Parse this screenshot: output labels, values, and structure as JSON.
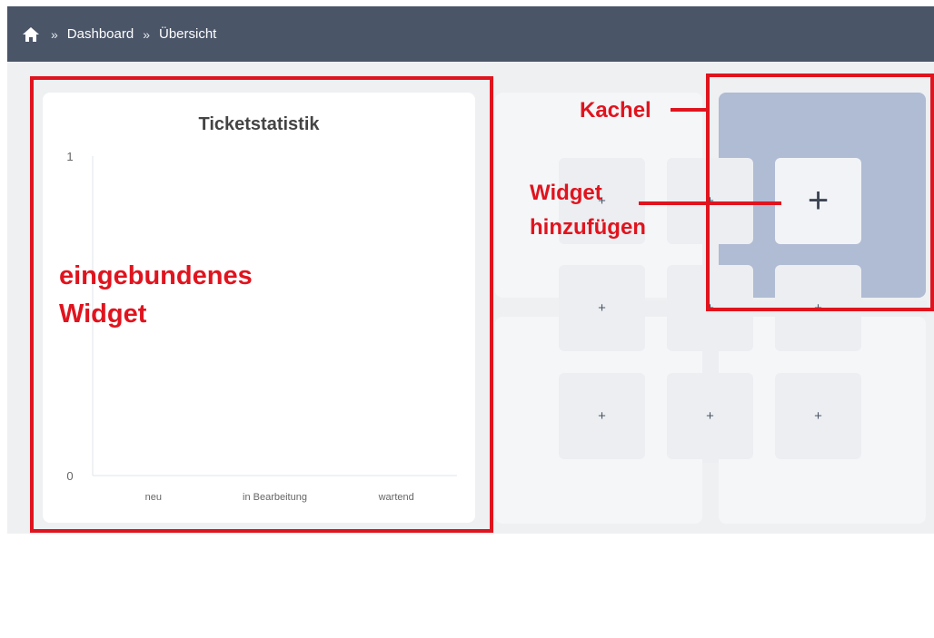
{
  "breadcrumb": {
    "items": [
      "Dashboard",
      "Übersicht"
    ],
    "separator": "»"
  },
  "widget": {
    "title": "Ticketstatistik",
    "chart_data": {
      "type": "bar",
      "title": "Ticketstatistik",
      "categories": [
        "neu",
        "in Bearbeitung",
        "wartend"
      ],
      "values": [
        0,
        0,
        0
      ],
      "ylim": [
        0,
        1
      ],
      "yticks": [
        "1",
        "0"
      ],
      "grid": false
    }
  },
  "tiles": {
    "add_label": "+"
  },
  "annotations": {
    "embedded": "eingebundenes Widget",
    "tile": "Kachel",
    "add_widget": "Widget hinzufügen"
  },
  "colors": {
    "topbar": "#4a5568",
    "annotation": "#e0141e",
    "active_tile": "#b0bbd4"
  }
}
